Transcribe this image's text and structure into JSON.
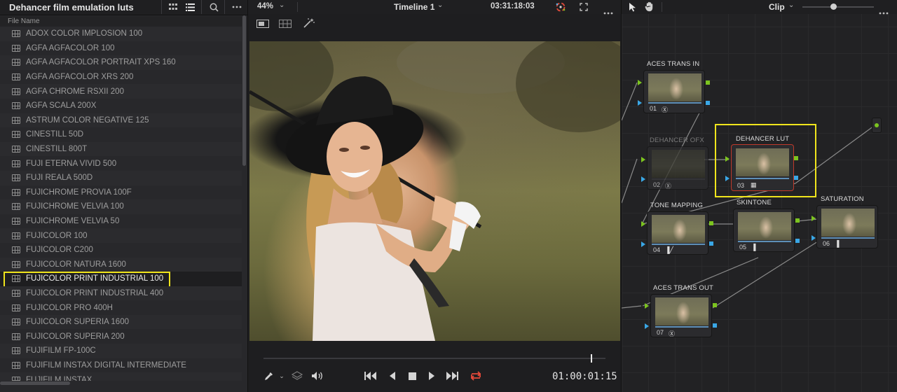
{
  "left_panel": {
    "title": "Dehancer film emulation luts",
    "column_header": "File Name",
    "items": [
      "ADOX COLOR IMPLOSION 100",
      "AGFA AGFACOLOR 100",
      "AGFA AGFACOLOR PORTRAIT XPS 160",
      "AGFA AGFACOLOR XRS 200",
      "AGFA CHROME RSXII 200",
      "AGFA SCALA 200X",
      "ASTRUM COLOR NEGATIVE 125",
      "CINESTILL 50D",
      "CINESTILL 800T",
      "FUJI ETERNA VIVID 500",
      "FUJI REALA 500D",
      "FUJICHROME PROVIA 100F",
      "FUJICHROME VELVIA 100",
      "FUJICHROME VELVIA 50",
      "FUJICOLOR 100",
      "FUJICOLOR C200",
      "FUJICOLOR NATURA 1600",
      "FUJICOLOR PRINT INDUSTRIAL 100",
      "FUJICOLOR PRINT INDUSTRIAL 400",
      "FUJICOLOR PRO 400H",
      "FUJICOLOR SUPERIA 1600",
      "FUJICOLOR SUPERIA 200",
      "FUJIFILM FP-100C",
      "FUJIFILM INSTAX DIGITAL INTERMEDIATE",
      "FUJIFILM INSTAX"
    ],
    "selected": "FUJICOLOR PRINT INDUSTRIAL 100",
    "icons": [
      "grid-view-icon",
      "list-view-icon",
      "search-icon",
      "more-icon"
    ]
  },
  "viewer": {
    "zoom": "44%",
    "timeline": "Timeline 1",
    "timecode_top": "03:31:18:03",
    "timecode": "01:00:01:15"
  },
  "node_editor": {
    "mode": "Clip",
    "nodes": [
      {
        "label": "ACES TRANS IN",
        "num": "01"
      },
      {
        "label": "DEHANCER OFX",
        "num": "02"
      },
      {
        "label": "DEHANCER LUT",
        "num": "03"
      },
      {
        "label": "TONE MAPPING",
        "num": "04"
      },
      {
        "label": "SKINTONE",
        "num": "05"
      },
      {
        "label": "SATURATION",
        "num": "06"
      },
      {
        "label": "ACES TRANS OUT",
        "num": "07"
      }
    ]
  },
  "colors": {
    "highlight": "#f0e51c",
    "port_green": "#7cc41f",
    "port_blue": "#3aa7e6",
    "node_selected_border": "#c0392b",
    "playhead_loop": "#e5493a"
  }
}
